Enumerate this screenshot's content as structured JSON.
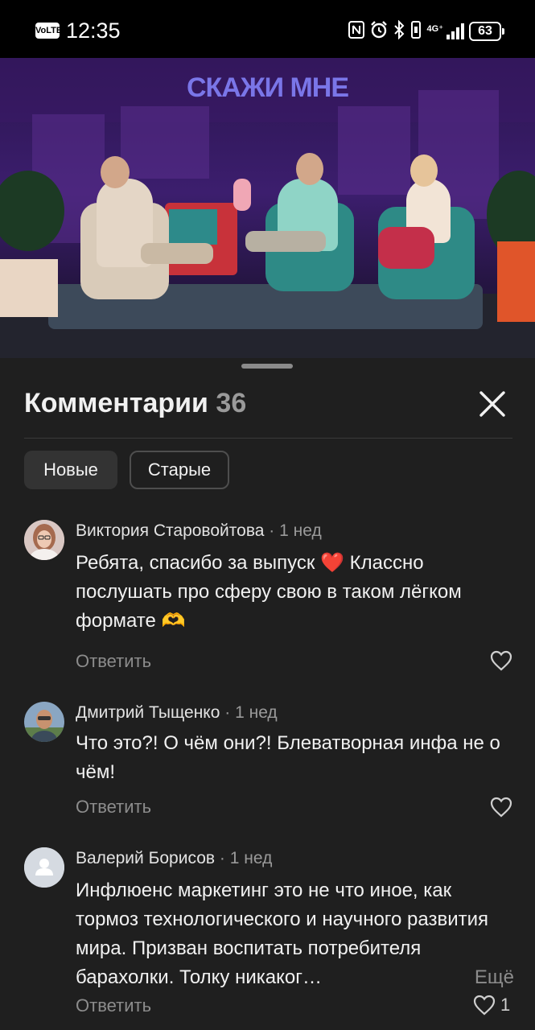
{
  "status_bar": {
    "volte": "VoLTE",
    "time": "12:35",
    "network": "4G⁺",
    "battery": "63"
  },
  "video": {
    "title": "СКАЖИ МНЕ"
  },
  "comments_sheet": {
    "title": "Комментарии",
    "count": "36",
    "sort": {
      "new": "Новые",
      "old": "Старые"
    }
  },
  "comments": [
    {
      "author": "Виктория Старовойтова",
      "sep": "·",
      "time": "1 нед",
      "text_1": "Ребята, спасибо за выпуск ❤️ Классно послушать про сферу свою в таком лёгком формате 🫶",
      "reply": "Ответить",
      "likes": ""
    },
    {
      "author": "Дмитрий Тыщенко",
      "sep": "·",
      "time": "1 нед",
      "text_1": "Что это?! О чём они?! Блеватворная инфа не о чём!",
      "reply": "Ответить",
      "likes": ""
    },
    {
      "author": "Валерий Борисов",
      "sep": "·",
      "time": "1 нед",
      "text_1": "Инфлюенс маркетинг это не что иное, как тормоз технологического и научного развития мира. Призван воспитать потребителя барахолки. Толку никаког…",
      "more": "Ещё",
      "reply": "Ответить",
      "likes": "1"
    }
  ]
}
